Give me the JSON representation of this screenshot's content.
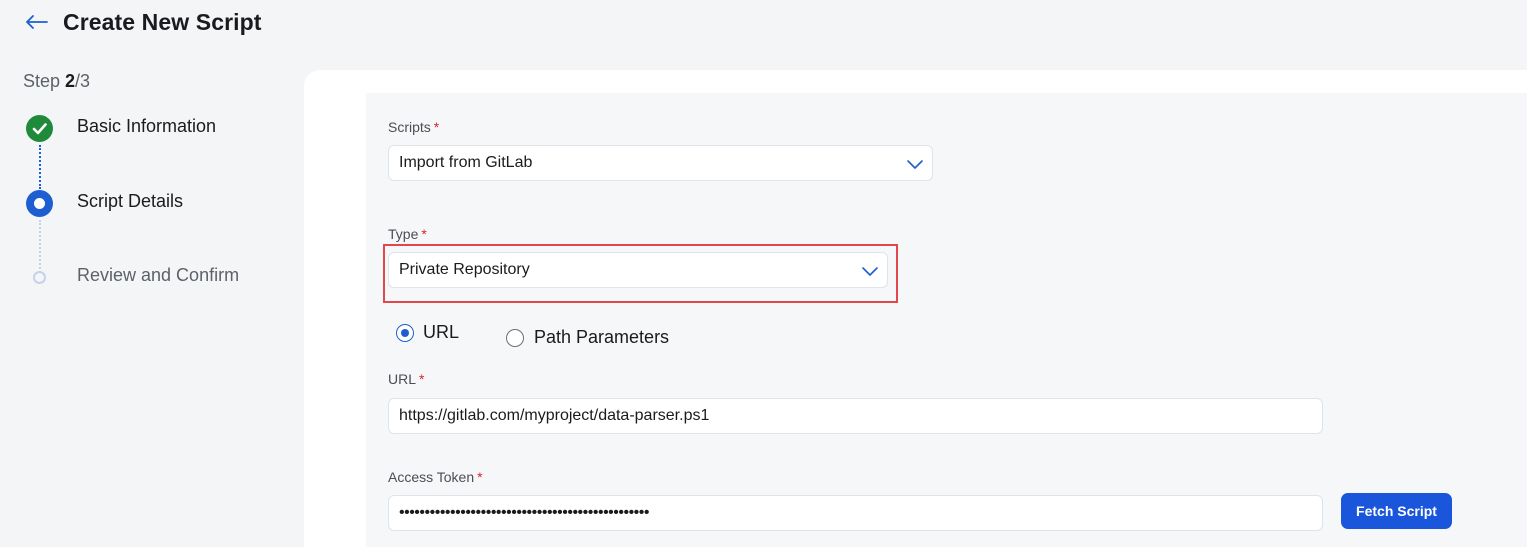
{
  "header": {
    "title": "Create New Script",
    "back_icon": "back-arrow-icon"
  },
  "stepper": {
    "prefix": "Step ",
    "current": "2",
    "total": "/3",
    "steps": [
      {
        "label": "Basic Information",
        "state": "done"
      },
      {
        "label": "Script Details",
        "state": "current"
      },
      {
        "label": "Review and Confirm",
        "state": "future"
      }
    ]
  },
  "form": {
    "scripts": {
      "label": "Scripts",
      "required": "*",
      "value": "Import from GitLab"
    },
    "type": {
      "label": "Type",
      "required": "*",
      "value": "Private Repository"
    },
    "mode": {
      "options": [
        {
          "label": "URL",
          "checked": true
        },
        {
          "label": "Path Parameters",
          "checked": false
        }
      ]
    },
    "url": {
      "label": "URL",
      "required": "*",
      "value": "https://gitlab.com/myproject/data-parser.ps1"
    },
    "token": {
      "label": "Access Token",
      "required": "*",
      "value": "•••••••••••••••••••••••••••••••••••••••••••••••••"
    },
    "fetch_label": "Fetch Script"
  },
  "colors": {
    "primary": "#1a56db",
    "success": "#1f8a3a",
    "required": "#d7262a",
    "highlight": "#e2474b"
  }
}
